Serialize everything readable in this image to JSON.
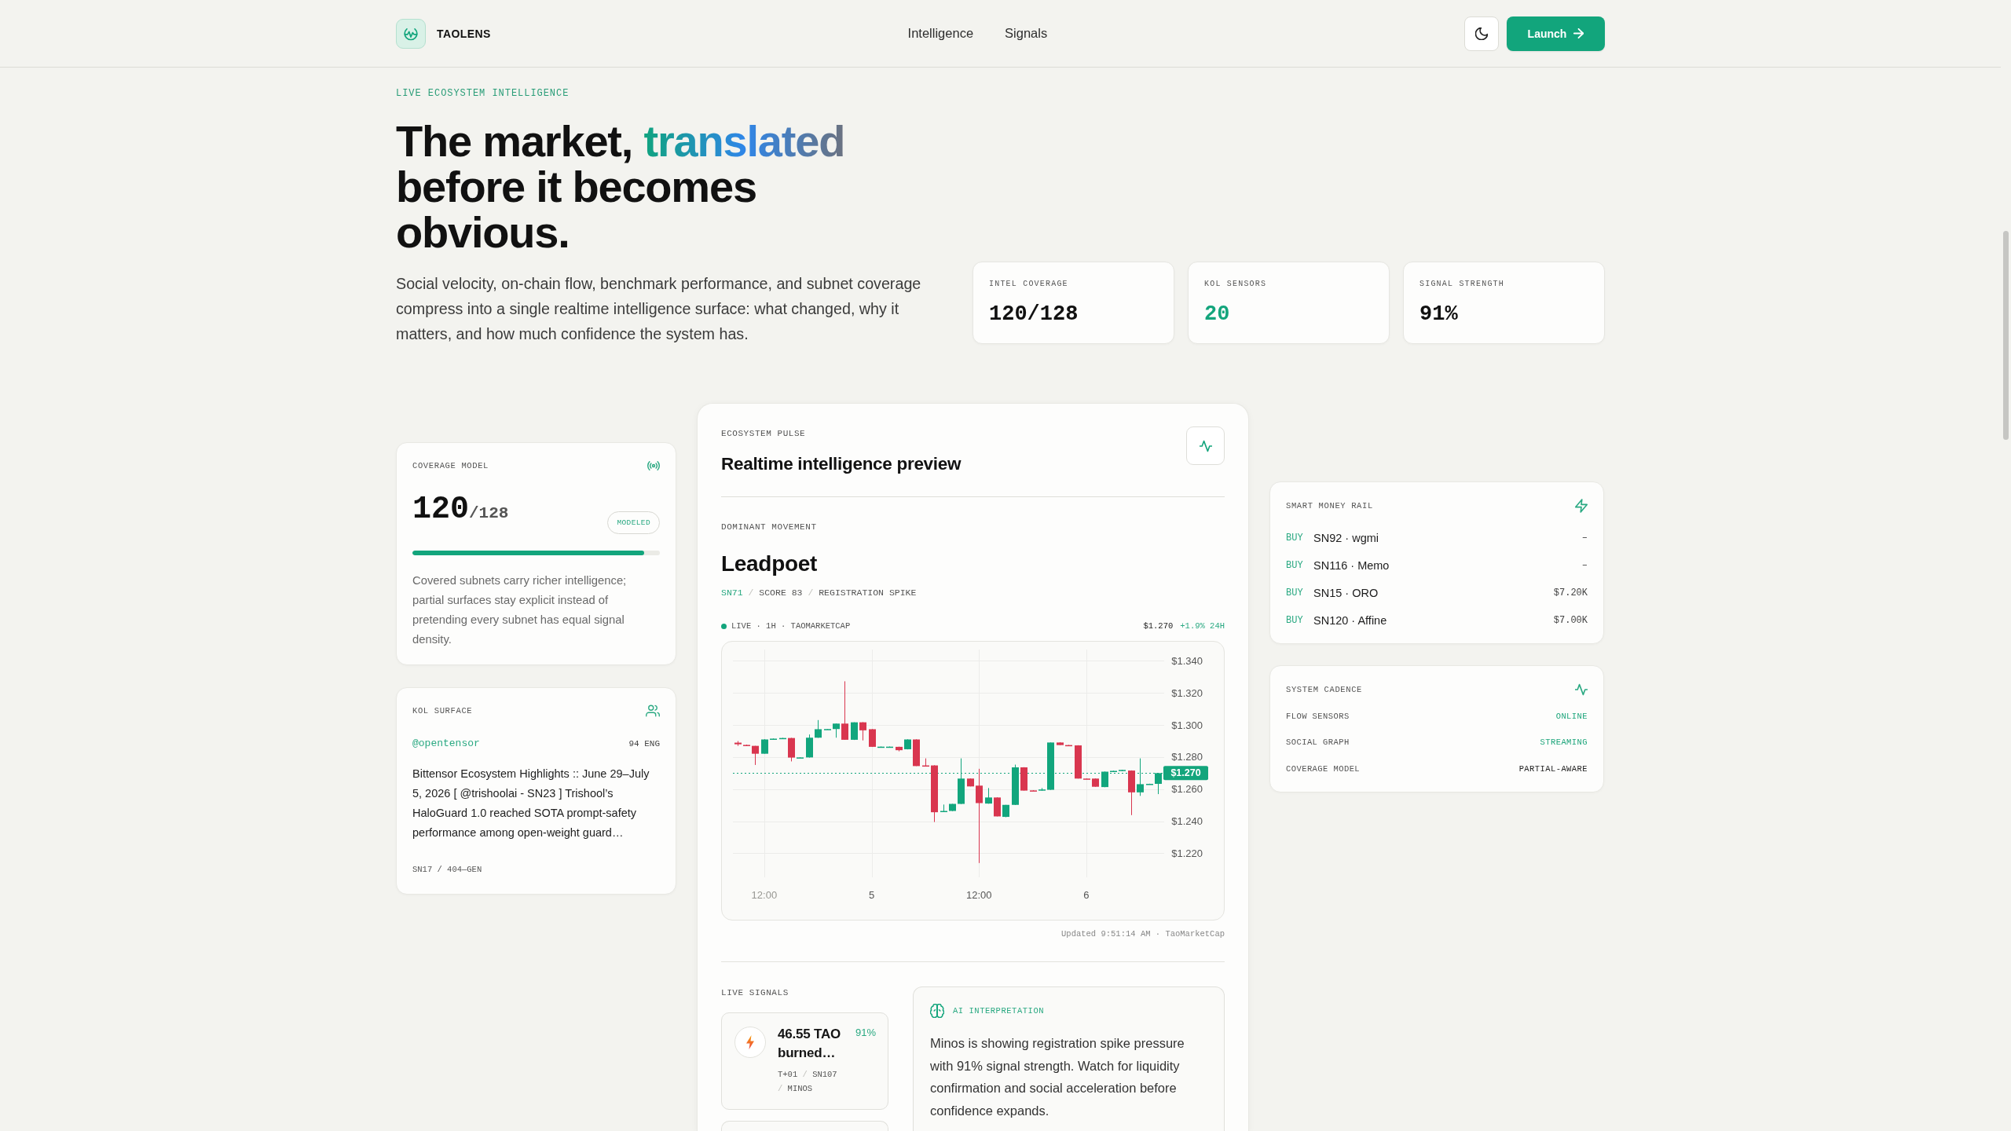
{
  "header": {
    "brand": "TAOLENS",
    "nav": [
      {
        "label": "Intelligence"
      },
      {
        "label": "Signals"
      }
    ],
    "launch_button": "Launch"
  },
  "hero": {
    "eyebrow": "LIVE ECOSYSTEM INTELLIGENCE",
    "headline": {
      "lead": "The market, ",
      "highlight": "translated",
      "tail": " before it becomes obvious."
    },
    "description": "Social velocity, on-chain flow, benchmark performance, and subnet coverage compress into a single realtime intelligence surface: what changed, why it matters, and how much confidence the system has.",
    "stats": [
      {
        "label": "INTEL COVERAGE",
        "value": "120/128",
        "color": "#111111"
      },
      {
        "label": "KOL SENSORS",
        "value": "20",
        "color": "#13a57c"
      },
      {
        "label": "SIGNAL STRENGTH",
        "value": "91%",
        "color": "#111111"
      }
    ]
  },
  "coverage_model": {
    "title": "COVERAGE MODEL",
    "covered": "120",
    "total": "/128",
    "badge": "MODELED",
    "level": 0.9375,
    "description": "Covered subnets carry richer intelligence; partial surfaces stay explicit instead of pretending every subnet has equal signal density."
  },
  "kol_surface": {
    "title": "KOL SURFACE",
    "handle": "@opentensor",
    "engagement": "94 ENG",
    "post": "Bittensor Ecosystem Highlights :: June 29–July 5, 2026 [ @trishoolai - SN23 ] Trishool’s HaloGuard 1.0 reached SOTA prompt-safety performance among open-weight guard…",
    "meta": "SN17 / 404—GEN"
  },
  "ecosystem_pulse": {
    "eyebrow": "ECOSYSTEM PULSE",
    "title": "Realtime intelligence preview",
    "dominant": {
      "label": "DOMINANT MOVEMENT",
      "name": "Leadpoet",
      "tags": [
        "SN71",
        "SCORE 83",
        "REGISTRATION SPIKE"
      ],
      "separator": "/"
    },
    "feed": {
      "source": "LIVE · 1H · TAOMARKETCAP",
      "price": "$1.270",
      "change": "+1.9% 24H"
    },
    "chart_data": [
      {
        "type": "candlestick",
        "categories": [
          null,
          null,
          null,
          "12:00",
          null,
          null,
          null,
          null,
          null,
          null,
          null,
          null,
          null,
          null,
          null,
          "5",
          null,
          null,
          null,
          null,
          null,
          null,
          null,
          null,
          null,
          null,
          null,
          "12:00",
          null,
          null,
          null,
          null,
          null,
          null,
          null,
          null,
          null,
          null,
          null,
          "6",
          null,
          null,
          null,
          null,
          null,
          null,
          null,
          null
        ],
        "ohlc": [
          [
            1.289,
            1.29,
            1.287,
            1.288
          ],
          [
            1.2876,
            1.2878,
            1.287,
            1.2872
          ],
          [
            1.287,
            1.287,
            1.2751,
            1.2821
          ],
          [
            1.2821,
            1.2912,
            1.2821,
            1.291
          ],
          [
            1.2912,
            1.2916,
            1.291,
            1.2915
          ],
          [
            1.2915,
            1.292,
            1.2914,
            1.2919
          ],
          [
            1.2919,
            1.292,
            1.2773,
            1.2797
          ],
          [
            1.2796,
            1.2799,
            1.2795,
            1.2798
          ],
          [
            1.2798,
            1.2941,
            1.2797,
            1.2921
          ],
          [
            1.2921,
            1.3031,
            1.292,
            1.2974
          ],
          [
            1.2973,
            1.2976,
            1.2972,
            1.2975
          ],
          [
            1.2975,
            1.3009,
            1.2921,
            1.3009
          ],
          [
            1.3009,
            1.3273,
            1.2908,
            1.2908
          ],
          [
            1.2908,
            1.3017,
            1.2907,
            1.3017
          ],
          [
            1.3017,
            1.3018,
            1.2904,
            1.2967
          ],
          [
            1.2974,
            1.2975,
            1.2864,
            1.2864
          ],
          [
            1.2864,
            1.2866,
            1.2863,
            1.2865
          ],
          [
            1.2864,
            1.2866,
            1.2863,
            1.2865
          ],
          [
            1.2864,
            1.2865,
            1.2836,
            1.2843
          ],
          [
            1.2849,
            1.2911,
            1.2848,
            1.291
          ],
          [
            1.291,
            1.2911,
            1.2744,
            1.2744
          ],
          [
            1.2748,
            1.2792,
            1.2744,
            1.2745
          ],
          [
            1.2748,
            1.2749,
            1.2395,
            1.2456
          ],
          [
            1.246,
            1.2504,
            1.2459,
            1.2464
          ],
          [
            1.2464,
            1.2508,
            1.2463,
            1.2508
          ],
          [
            1.2508,
            1.2792,
            1.2507,
            1.2666
          ],
          [
            1.2666,
            1.2667,
            1.2617,
            1.2617
          ],
          [
            1.2622,
            1.2727,
            1.2139,
            1.2513
          ],
          [
            1.251,
            1.2607,
            1.2509,
            1.2548
          ],
          [
            1.2548,
            1.2549,
            1.243,
            1.243
          ],
          [
            1.2427,
            1.2502,
            1.2425,
            1.2502
          ],
          [
            1.2502,
            1.2753,
            1.2501,
            1.2736
          ],
          [
            1.2736,
            1.2737,
            1.2591,
            1.2591
          ],
          [
            1.2592,
            1.2593,
            1.2589,
            1.259
          ],
          [
            1.2591,
            1.2607,
            1.259,
            1.2598
          ],
          [
            1.2596,
            1.2891,
            1.2595,
            1.2891
          ],
          [
            1.2891,
            1.2893,
            1.2875,
            1.2875
          ],
          [
            1.2875,
            1.2876,
            1.2872,
            1.2873
          ],
          [
            1.2873,
            1.2874,
            1.2666,
            1.2666
          ],
          [
            1.2666,
            1.2667,
            1.2662,
            1.2663
          ],
          [
            1.2666,
            1.2667,
            1.2615,
            1.2615
          ],
          [
            1.2613,
            1.271,
            1.2612,
            1.2709
          ],
          [
            1.2712,
            1.2715,
            1.2711,
            1.2714
          ],
          [
            1.2714,
            1.2721,
            1.2713,
            1.272
          ],
          [
            1.2716,
            1.2717,
            1.2438,
            1.258
          ],
          [
            1.258,
            1.2792,
            1.2558,
            1.2631
          ],
          [
            1.2631,
            1.2634,
            1.263,
            1.2633
          ],
          [
            1.2633,
            1.27,
            1.2569,
            1.27
          ]
        ],
        "ylim": [
          1.205,
          1.352
        ],
        "yticks": [
          {
            "value": 1.34,
            "label": "$1.340"
          },
          {
            "value": 1.32,
            "label": "$1.320"
          },
          {
            "value": 1.3,
            "label": "$1.300"
          },
          {
            "value": 1.28,
            "label": "$1.280"
          },
          {
            "value": 1.26,
            "label": "$1.260"
          },
          {
            "value": 1.24,
            "label": "$1.240"
          },
          {
            "value": 1.22,
            "label": "$1.220"
          }
        ],
        "grid": true,
        "ref_lines": [
          {
            "axis": "y",
            "value": 1.27,
            "label": "$1.270",
            "color": "#13a57c",
            "line_style": "dotted"
          }
        ]
      }
    ],
    "updated": "Updated 9:51:14 AM · TaoMarketCap",
    "live_signals": {
      "label": "LIVE SIGNALS",
      "items": [
        {
          "kind": "burn",
          "title": "46.55 TAO burned…",
          "confidence": "91%",
          "meta": [
            "T+01",
            "SN107",
            "MINOS"
          ],
          "separator": "/"
        },
        {
          "kind": "clipped"
        }
      ]
    },
    "ai_interpretation": {
      "label": "AI INTERPRETATION",
      "text": "Minos is showing registration spike pressure with 91% signal strength. Watch for liquidity confirmation and social acceleration before confidence expands."
    }
  },
  "smart_money_rail": {
    "title": "SMART MONEY RAIL",
    "rows": [
      {
        "side": "BUY",
        "subnet": "SN92 · wgmi",
        "amount": "–"
      },
      {
        "side": "BUY",
        "subnet": "SN116 · Memo",
        "amount": "–"
      },
      {
        "side": "BUY",
        "subnet": "SN15 · ORO",
        "amount": "$7.20K"
      },
      {
        "side": "BUY",
        "subnet": "SN120 · Affine",
        "amount": "$7.00K"
      }
    ]
  },
  "system_cadence": {
    "title": "SYSTEM CADENCE",
    "rows": [
      {
        "label": "FLOW SENSORS",
        "value": "ONLINE",
        "color": "#1fa67c"
      },
      {
        "label": "SOCIAL GRAPH",
        "value": "STREAMING",
        "color": "#1fa67c"
      },
      {
        "label": "COVERAGE MODEL",
        "value": "PARTIAL-AWARE",
        "color": "#222222"
      }
    ]
  }
}
